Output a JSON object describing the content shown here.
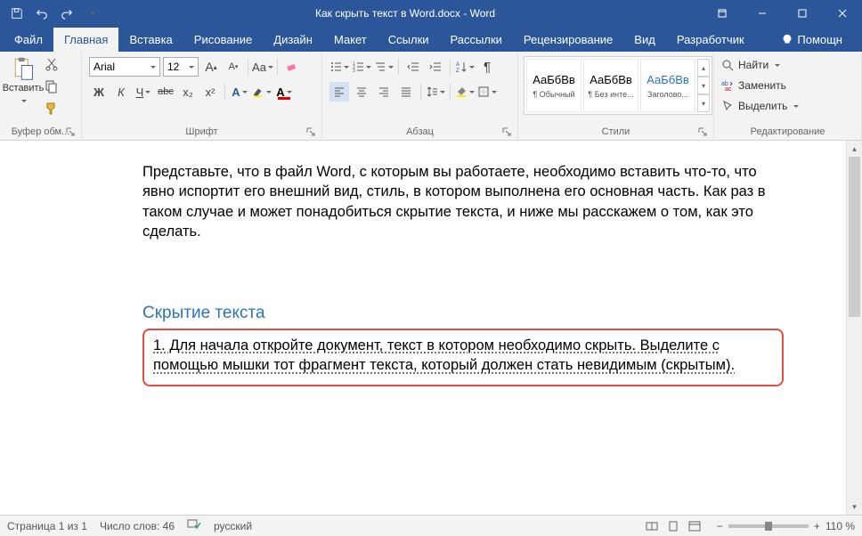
{
  "titlebar": {
    "doc_title": "Как скрыть текст в Word.docx - Word"
  },
  "tabs": {
    "file": "Файл",
    "home": "Главная",
    "insert": "Вставка",
    "draw": "Рисование",
    "design": "Дизайн",
    "layout": "Макет",
    "references": "Ссылки",
    "mailings": "Рассылки",
    "review": "Рецензирование",
    "view": "Вид",
    "developer": "Разработчик",
    "help": "Помощн"
  },
  "ribbon": {
    "clipboard": {
      "paste": "Вставить",
      "group": "Буфер обм..."
    },
    "font": {
      "name": "Arial",
      "size": "12",
      "bold": "Ж",
      "italic": "К",
      "underline": "Ч",
      "strike": "abc",
      "sub": "x₂",
      "sup": "x²",
      "Aa": "Aa",
      "grow": "A",
      "shrink": "A",
      "Aletter": "A",
      "clear": "",
      "group": "Шрифт"
    },
    "paragraph": {
      "group": "Абзац"
    },
    "styles": {
      "group": "Стили",
      "preview": "АаБбВв",
      "items": [
        {
          "label": "¶ Обычный"
        },
        {
          "label": "¶ Без инте..."
        },
        {
          "label": "Заголово..."
        }
      ]
    },
    "editing": {
      "find": "Найти",
      "replace": "Заменить",
      "select": "Выделить",
      "group": "Редактирование"
    }
  },
  "document": {
    "para1": "Представьте, что в файл Word, с которым вы работаете, необходимо вставить что-то, что явно испортит его внешний вид, стиль, в котором выполнена его основная часть. Как раз в таком случае и может понадобиться скрытие текста, и ниже мы расскажем о том, как это сделать.",
    "heading": "Скрытие текста",
    "selected": "1. Для начала откройте документ, текст в котором необходимо скрыть. Выделите с помощью мышки тот фрагмент текста, который должен стать невидимым (скрытым)."
  },
  "status": {
    "page": "Страница 1 из 1",
    "words": "Число слов: 46",
    "lang": "русский",
    "zoom": "110 %"
  }
}
